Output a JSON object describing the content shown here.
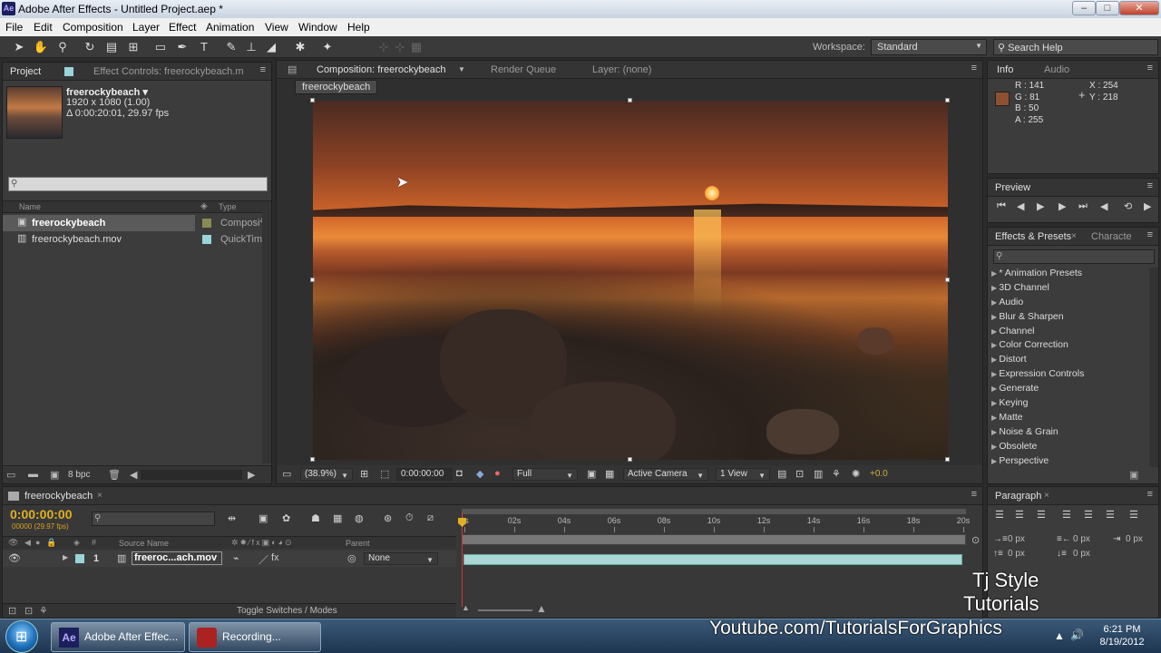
{
  "window": {
    "title": "Adobe After Effects - Untitled Project.aep *",
    "app_icon": "Ae"
  },
  "menu": [
    "File",
    "Edit",
    "Composition",
    "Layer",
    "Effect",
    "Animation",
    "View",
    "Window",
    "Help"
  ],
  "toolbar": {
    "workspace_label": "Workspace:",
    "workspace_value": "Standard",
    "search_placeholder": "Search Help"
  },
  "project": {
    "tab_project": "Project",
    "tab_effect_controls": "Effect Controls: freerockybeach.m",
    "item_name": "freerockybeach ▾",
    "item_res": "1920 x 1080 (1.00)",
    "item_duration": "Δ 0:00:20:01, 29.97 fps",
    "col_name": "Name",
    "col_type": "Type",
    "items": [
      {
        "name": "freerockybeach",
        "type": "Composi",
        "color": "#8a8a55"
      },
      {
        "name": "freerockybeach.mov",
        "type": "QuickTim",
        "color": "#9ad3d9"
      }
    ],
    "bpc": "8 bpc"
  },
  "composition": {
    "tab_comp": "Composition: freerockybeach",
    "tab_render": "Render Queue",
    "tab_layer": "Layer: (none)",
    "breadcrumb": "freerockybeach",
    "zoom": "(38.9%)",
    "timecode": "0:00:00:00",
    "resolution": "Full",
    "camera": "Active Camera",
    "views": "1 View",
    "exposure": "+0.0"
  },
  "info": {
    "tab_info": "Info",
    "tab_audio": "Audio",
    "r": "R : 141",
    "g": "G : 81",
    "b": "B : 50",
    "a": "A : 255",
    "x": "X : 254",
    "y": "Y : 218",
    "swatch": "#8d5132"
  },
  "preview": {
    "tab": "Preview"
  },
  "effects": {
    "tab": "Effects & Presets",
    "tab2": "Characte",
    "items": [
      "* Animation Presets",
      "3D Channel",
      "Audio",
      "Blur & Sharpen",
      "Channel",
      "Color Correction",
      "Distort",
      "Expression Controls",
      "Generate",
      "Keying",
      "Matte",
      "Noise & Grain",
      "Obsolete",
      "Perspective"
    ]
  },
  "timeline": {
    "tab": "freerockybeach",
    "timecode": "0:00:00:00",
    "frames": "00000 (29.97 fps)",
    "col_source": "Source Name",
    "col_parent": "Parent",
    "ticks": [
      "0s",
      "02s",
      "04s",
      "06s",
      "08s",
      "10s",
      "12s",
      "14s",
      "16s",
      "18s",
      "20s"
    ],
    "layer_num": "1",
    "layer_name": "freeroc...ach.mov",
    "parent_value": "None",
    "toggle": "Toggle Switches / Modes"
  },
  "paragraph": {
    "tab": "Paragraph",
    "px1": "0 px",
    "px2": "0 px",
    "px3": "0 px",
    "px4": "0 px",
    "px5": "0 px"
  },
  "watermark": {
    "line1": "Tj Style",
    "line2": "Tutorials",
    "url": "Youtube.com/TutorialsForGraphics"
  },
  "taskbar": {
    "btn_ae": "Adobe After Effec...",
    "btn_rec": "Recording...",
    "time": "6:21 PM",
    "date": "8/19/2012"
  }
}
